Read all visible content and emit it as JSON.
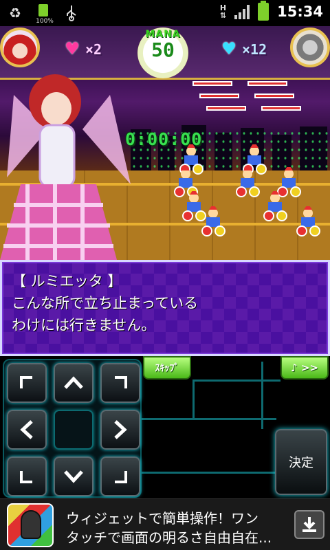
{
  "status_bar": {
    "battery_small_pct": "100%",
    "network_label_top": "H",
    "time": "15:34",
    "icons": [
      "recycle-icon",
      "battery-full-icon",
      "usb-icon",
      "h-data-icon",
      "signal-icon",
      "battery-icon"
    ]
  },
  "hud": {
    "player_lives": "×2",
    "enemy_lives": "×12",
    "mana_label": "MANA",
    "mana_value": "50",
    "timer": "0:00:00"
  },
  "dialog": {
    "speaker": "【 ルミエッタ 】",
    "lines": [
      "こんな所で立ち止まっている",
      "わけには行きません。"
    ]
  },
  "controls": {
    "skip_label": "ｽｷｯﾌﾟ",
    "music_label": "♪ >>",
    "decide_label": "決定",
    "arrows": {
      "up": "^",
      "down": "v",
      "left": "<",
      "right": ">"
    }
  },
  "ad": {
    "line1": "ウィジェットで簡単操作！ワン",
    "line2": "タッチで画面の明るさ自由自在..."
  },
  "colors": {
    "dialog_bg": "#5a1aa8",
    "mana_text": "#3ad020",
    "timer_text": "#38e050",
    "button_green": "#4ab818",
    "circuit": "#0e6a70"
  }
}
